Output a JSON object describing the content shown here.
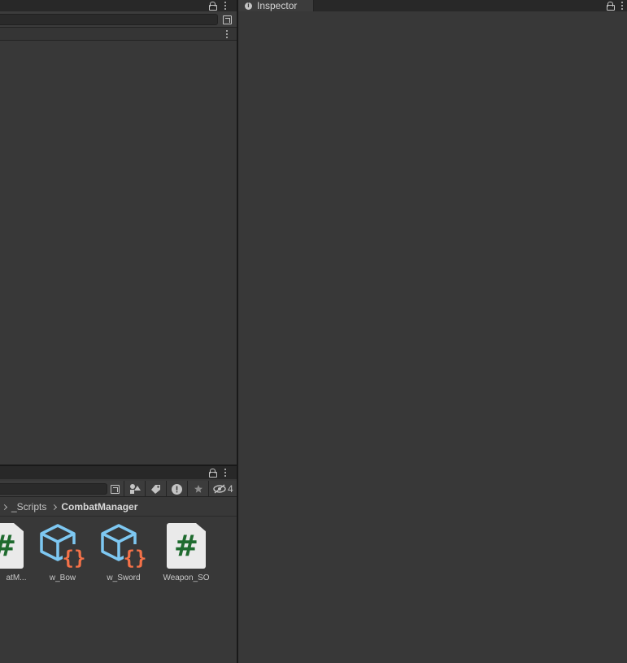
{
  "inspector": {
    "tab_label": "Inspector",
    "info_glyph": "i"
  },
  "project": {
    "hidden_count": "4",
    "breadcrumb": [
      "_Scripts",
      "CombatManager"
    ],
    "assets": [
      {
        "label": "atM...",
        "icon": "csharp-script-icon"
      },
      {
        "label": "w_Bow",
        "icon": "scriptable-object-icon"
      },
      {
        "label": "w_Sword",
        "icon": "scriptable-object-icon"
      },
      {
        "label": "Weapon_SO",
        "icon": "csharp-script-icon"
      }
    ],
    "script_glyph": "#"
  },
  "colors": {
    "panel": "#383838",
    "tab_bar": "#282828",
    "divider": "#191919",
    "csharp_green": "#1f6b2f",
    "so_cube_blue": "#7ec8f2",
    "so_braces_orange": "#f47148"
  }
}
